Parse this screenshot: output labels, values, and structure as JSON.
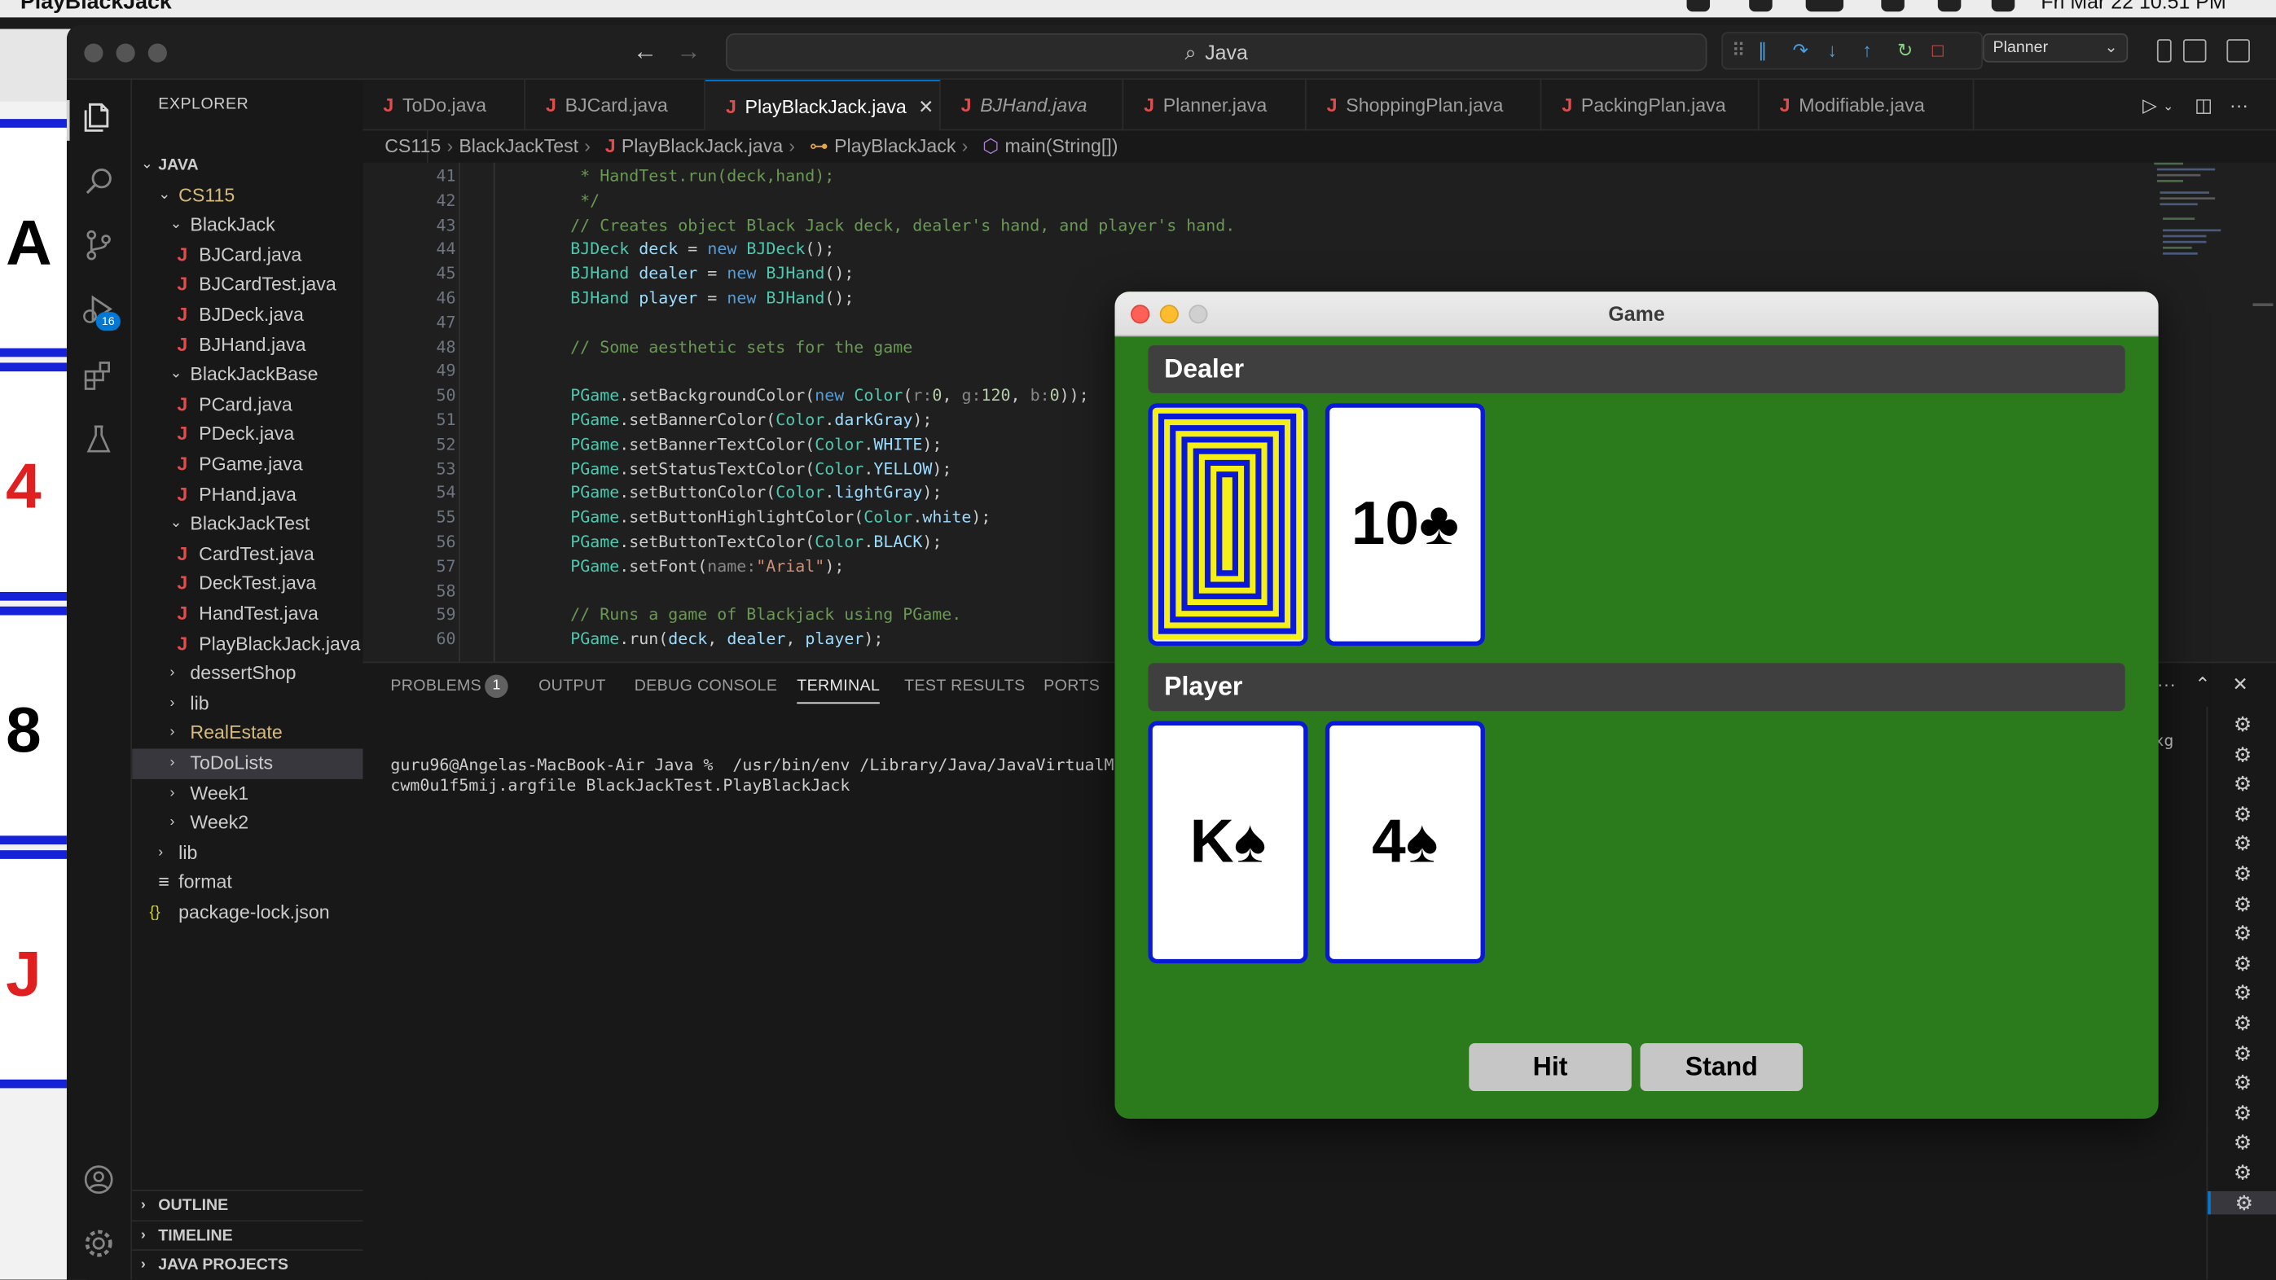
{
  "menubar": {
    "app_name": "PlayBlackJack",
    "clock": "Fri Mar 22 10:51 PM"
  },
  "bg_window": {
    "cards": [
      "A",
      "4",
      "8",
      "J"
    ]
  },
  "titlebar": {
    "search_text": "Java",
    "launch_config": "Planner"
  },
  "activity": {
    "run_badge": "16"
  },
  "sidebar": {
    "header": "EXPLORER",
    "more": "···",
    "tree": [
      {
        "label": "JAVA",
        "kind": "root"
      },
      {
        "label": "CS115",
        "kind": "folder-mod"
      },
      {
        "label": "BlackJack",
        "kind": "folder"
      },
      {
        "label": "BJCard.java",
        "kind": "java"
      },
      {
        "label": "BJCardTest.java",
        "kind": "java"
      },
      {
        "label": "BJDeck.java",
        "kind": "java"
      },
      {
        "label": "BJHand.java",
        "kind": "java"
      },
      {
        "label": "BlackJackBase",
        "kind": "folder"
      },
      {
        "label": "PCard.java",
        "kind": "java"
      },
      {
        "label": "PDeck.java",
        "kind": "java"
      },
      {
        "label": "PGame.java",
        "kind": "java"
      },
      {
        "label": "PHand.java",
        "kind": "java"
      },
      {
        "label": "BlackJackTest",
        "kind": "folder"
      },
      {
        "label": "CardTest.java",
        "kind": "java"
      },
      {
        "label": "DeckTest.java",
        "kind": "java"
      },
      {
        "label": "HandTest.java",
        "kind": "java"
      },
      {
        "label": "PlayBlackJack.java",
        "kind": "java"
      },
      {
        "label": "dessertShop",
        "kind": "folder-closed"
      },
      {
        "label": "lib",
        "kind": "folder-closed"
      },
      {
        "label": "RealEstate",
        "kind": "folder-closed-mod"
      },
      {
        "label": "ToDoLists",
        "kind": "folder-closed-sel"
      },
      {
        "label": "Week1",
        "kind": "folder-closed"
      },
      {
        "label": "Week2",
        "kind": "folder-closed"
      },
      {
        "label": "lib",
        "kind": "folder-closed-top"
      },
      {
        "label": "format",
        "kind": "file"
      },
      {
        "label": "package-lock.json",
        "kind": "json"
      }
    ],
    "outline": "OUTLINE",
    "timeline": "TIMELINE",
    "java_projects": "JAVA PROJECTS"
  },
  "tabs": [
    {
      "label": "ToDo.java"
    },
    {
      "label": "BJCard.java"
    },
    {
      "label": "PlayBlackJack.java",
      "active": true
    },
    {
      "label": "BJHand.java",
      "italic": true
    },
    {
      "label": "Planner.java"
    },
    {
      "label": "ShoppingPlan.java"
    },
    {
      "label": "PackingPlan.java"
    },
    {
      "label": "Modifiable.java"
    }
  ],
  "breadcrumb": {
    "p1": "CS115",
    "p2": "BlackJackTest",
    "p3": "PlayBlackJack.java",
    "p4": "PlayBlackJack",
    "p5": "main(String[])"
  },
  "code": {
    "lines": [
      {
        "n": "41",
        "t": "     * HandTest.run(deck,hand);"
      },
      {
        "n": "42",
        "t": "     */"
      },
      {
        "n": "43",
        "t": "    // Creates object Black Jack deck, dealer's hand, and player's hand."
      },
      {
        "n": "44",
        "t": "    BJDeck deck = new BJDeck();"
      },
      {
        "n": "45",
        "t": "    BJHand dealer = new BJHand();"
      },
      {
        "n": "46",
        "t": "    BJHand player = new BJHand();"
      },
      {
        "n": "47",
        "t": ""
      },
      {
        "n": "48",
        "t": "    // Some aesthetic sets for the game"
      },
      {
        "n": "49",
        "t": ""
      },
      {
        "n": "50",
        "t": "    PGame.setBackgroundColor(new Color(r:0, g:120, b:0));"
      },
      {
        "n": "51",
        "t": "    PGame.setBannerColor(Color.darkGray);"
      },
      {
        "n": "52",
        "t": "    PGame.setBannerTextColor(Color.WHITE);"
      },
      {
        "n": "53",
        "t": "    PGame.setStatusTextColor(Color.YELLOW);"
      },
      {
        "n": "54",
        "t": "    PGame.setButtonColor(Color.lightGray);"
      },
      {
        "n": "55",
        "t": "    PGame.setButtonHighlightColor(Color.white);"
      },
      {
        "n": "56",
        "t": "    PGame.setButtonTextColor(Color.BLACK);"
      },
      {
        "n": "57",
        "t": "    PGame.setFont(name:\"Arial\");"
      },
      {
        "n": "58",
        "t": ""
      },
      {
        "n": "59",
        "t": "    // Runs a game of Blackjack using PGame."
      },
      {
        "n": "60",
        "t": "    PGame.run(deck, dealer, player);"
      }
    ]
  },
  "panel": {
    "tabs": [
      "PROBLEMS",
      "OUTPUT",
      "DEBUG CONSOLE",
      "TERMINAL",
      "TEST RESULTS",
      "PORTS"
    ],
    "problems_count": "1",
    "more": "···",
    "terminal_line1": "guru96@Angelas-MacBook-Air Java %  /usr/bin/env /Library/Java/JavaVirtualM",
    "terminal_line2": "cwm0u1f5mij.argfile BlackJackTest.PlayBlackJack",
    "terminal_tail": "xg"
  },
  "game": {
    "title": "Game",
    "dealer_label": "Dealer",
    "player_label": "Player",
    "dealer_card": "10♣",
    "player_cards": [
      "K♠",
      "4♠"
    ],
    "hit_label": "Hit",
    "stand_label": "Stand",
    "colors": {
      "felt": "#2b7a1b",
      "banner": "#3f3f3f",
      "card_border": "#0a18d8",
      "button": "#c6c6c6"
    }
  }
}
